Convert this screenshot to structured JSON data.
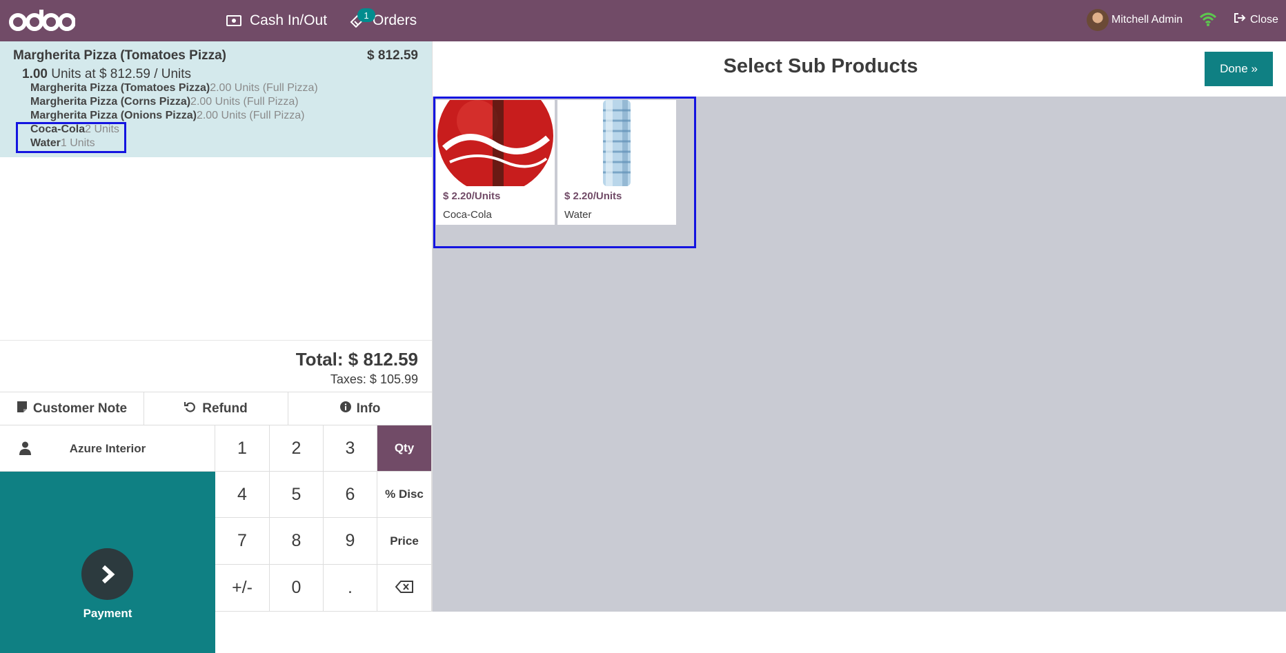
{
  "topbar": {
    "logo_text": "odoo",
    "cash_label": "Cash In/Out",
    "orders_label": "Orders",
    "orders_badge": "1",
    "user_name": "Mitchell Admin",
    "close_label": "Close"
  },
  "order": {
    "line_name": "Margherita Pizza (Tomatoes Pizza)",
    "line_price": "$ 812.59",
    "line_qty": "1.00",
    "line_unit_text": " Units at $ 812.59 / Units",
    "sub_lines": [
      {
        "name": "Margherita Pizza (Tomatoes Pizza)",
        "qty": "2.00 Units (Full Pizza)"
      },
      {
        "name": "Margherita Pizza (Corns Pizza)",
        "qty": "2.00 Units (Full Pizza)"
      },
      {
        "name": "Margherita Pizza (Onions Pizza)",
        "qty": "2.00 Units (Full Pizza)"
      },
      {
        "name": "Coca-Cola",
        "qty": "2 Units"
      },
      {
        "name": "Water",
        "qty": "1 Units"
      }
    ],
    "total": "Total: $ 812.59",
    "taxes": "Taxes: $ 105.99"
  },
  "controls": {
    "customer_note": "Customer Note",
    "refund": "Refund",
    "info": "Info",
    "customer": "Azure Interior",
    "payment": "Payment"
  },
  "numpad": {
    "keys": [
      "1",
      "2",
      "3",
      "4",
      "5",
      "6",
      "7",
      "8",
      "9",
      "+/-",
      "0",
      "."
    ],
    "modes": [
      "Qty",
      "% Disc",
      "Price"
    ],
    "active_mode": "Qty"
  },
  "subproducts": {
    "title": "Select Sub Products",
    "done": "Done »",
    "items": [
      {
        "name": "Coca-Cola",
        "price": "$ 2.20/Units"
      },
      {
        "name": "Water",
        "price": "$ 2.20/Units"
      }
    ]
  },
  "colors": {
    "brand": "#714B67",
    "teal": "#0f8083",
    "highlight": "#1414e0",
    "orderline_bg": "#d4e9ec"
  }
}
